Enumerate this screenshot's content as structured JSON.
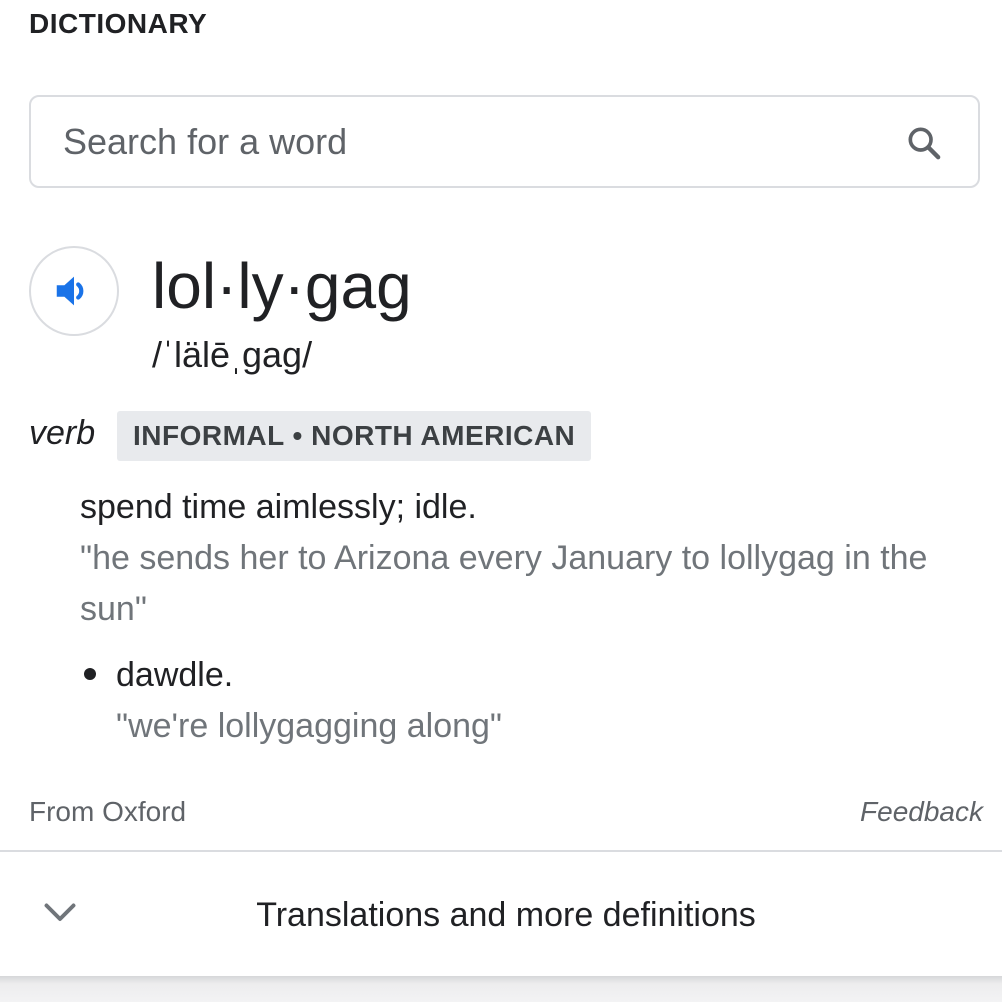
{
  "card": {
    "section_title": "DICTIONARY"
  },
  "search": {
    "placeholder": "Search for a word",
    "value": ""
  },
  "entry": {
    "headword": "lol·ly·gag",
    "pronunciation": "/ˈlälēˌgag/",
    "part_of_speech": "verb",
    "register": "INFORMAL • NORTH AMERICAN",
    "senses": [
      {
        "definition": "spend time aimlessly; idle.",
        "example": "\"he sends her to Arizona every January to lollygag in the sun\""
      }
    ],
    "subsenses": [
      {
        "definition": "dawdle.",
        "example": "\"we're lollygagging along\""
      }
    ]
  },
  "footer": {
    "source": "From Oxford",
    "feedback": "Feedback"
  },
  "more": {
    "label": "Translations and more definitions"
  },
  "icons": {
    "search": "search-icon",
    "audio": "speaker-icon",
    "expand": "chevron-down-icon"
  },
  "colors": {
    "accent": "#1a73e8",
    "text_primary": "#202124",
    "text_secondary": "#70757a",
    "tag_background": "#e8eaed",
    "border": "#dadce0"
  }
}
